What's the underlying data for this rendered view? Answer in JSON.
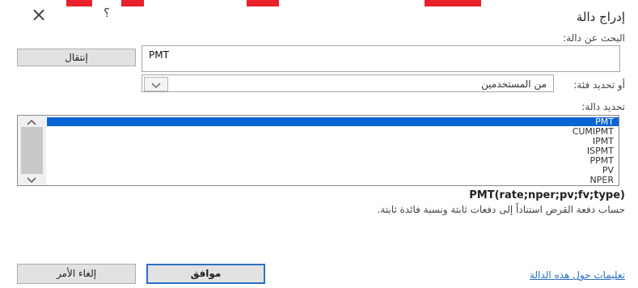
{
  "dialog": {
    "title": "إدراج دالة",
    "close_glyph": "×",
    "help_glyph": "؟"
  },
  "search": {
    "label": "البحث عن دالة:",
    "value": "PMT",
    "go_button": "إنتقال"
  },
  "category": {
    "label": "أو تحديد فئة:",
    "selected": "من المستخدمين"
  },
  "function_list": {
    "label": "تحديد دالة:",
    "items": [
      "PMT",
      "CUMIPMT",
      "IPMT",
      "ISPMT",
      "PPMT",
      "PV",
      "NPER"
    ],
    "selected_index": 0
  },
  "details": {
    "signature": "PMT(rate;nper;pv;fv;type)",
    "description": "حساب دفعة القرض استناداً إلى دفعات ثابتة ونسبة فائدة ثابتة."
  },
  "footer": {
    "help_link": "تعليمات حول هذه الدالة",
    "ok_button": "موافق",
    "cancel_button": "إلغاء الأمر"
  },
  "colors": {
    "selection": "#0a64d2",
    "link": "#2a6fc4",
    "top_marks": "#e8212b"
  }
}
